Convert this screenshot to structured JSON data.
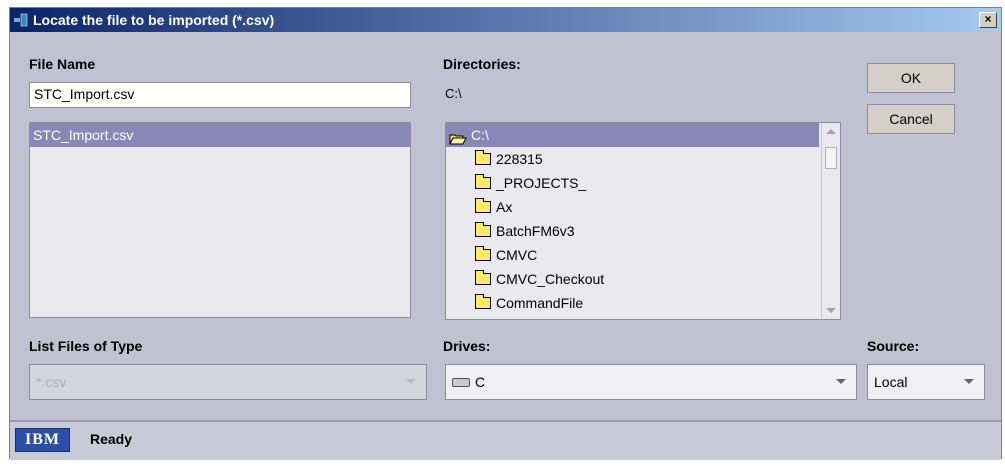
{
  "window": {
    "title": "Locate the file to be imported (*.csv)",
    "close_label": "×"
  },
  "file_name": {
    "label": "File Name",
    "value": "STC_Import.csv"
  },
  "file_list": {
    "items": [
      "STC_Import.csv"
    ]
  },
  "directories": {
    "label": "Directories:",
    "current": "C:\\"
  },
  "dir_list": {
    "root": "C:\\",
    "items": [
      "228315",
      "_PROJECTS_",
      "Ax",
      "BatchFM6v3",
      "CMVC",
      "CMVC_Checkout",
      "CommandFile"
    ]
  },
  "buttons": {
    "ok": "OK",
    "cancel": "Cancel"
  },
  "file_type": {
    "label": "List Files of Type",
    "value": "*.csv"
  },
  "drives": {
    "label": "Drives:",
    "value": "C"
  },
  "source": {
    "label": "Source:",
    "value": "Local"
  },
  "status": {
    "logo": "IBM",
    "text": "Ready"
  },
  "colors": {
    "title_start": "#0a246a",
    "title_end": "#a6caf0",
    "selection": "#8888b8",
    "body": "#c0c2d2"
  }
}
